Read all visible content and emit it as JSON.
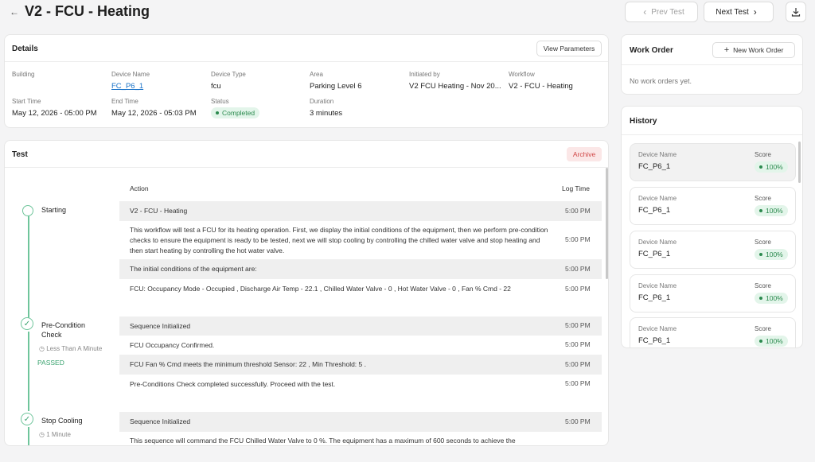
{
  "header": {
    "title": "V2 - FCU - Heating",
    "prev_label": "Prev Test",
    "next_label": "Next Test"
  },
  "details": {
    "title": "Details",
    "view_params_label": "View Parameters",
    "fields": {
      "building": {
        "label": "Building",
        "value": ""
      },
      "device_name": {
        "label": "Device Name",
        "value": "FC_P6_1"
      },
      "device_type": {
        "label": "Device Type",
        "value": "fcu"
      },
      "area": {
        "label": "Area",
        "value": "Parking Level 6"
      },
      "initiated_by": {
        "label": "Initiated by",
        "value": "V2 FCU Heating - Nov 20..."
      },
      "workflow": {
        "label": "Workflow",
        "value": "V2 - FCU - Heating"
      },
      "start_time": {
        "label": "Start Time",
        "value": "May 12, 2026 - 05:00 PM"
      },
      "end_time": {
        "label": "End Time",
        "value": "May 12, 2026 - 05:03 PM"
      },
      "status": {
        "label": "Status",
        "value": "Completed"
      },
      "duration": {
        "label": "Duration",
        "value": "3 minutes"
      }
    }
  },
  "test": {
    "title": "Test",
    "archive_label": "Archive",
    "col_action": "Action",
    "col_log_time": "Log Time",
    "steps": [
      {
        "label": "Starting",
        "sub": "",
        "result": ""
      },
      {
        "label": "Pre-Condition Check",
        "sub": "Less Than A Minute",
        "result": "PASSED"
      },
      {
        "label": "Stop Cooling",
        "sub": "1 Minute",
        "result": ""
      }
    ],
    "rows": [
      {
        "text": "V2 - FCU - Heating",
        "time": "5:00 PM"
      },
      {
        "text": "This workflow will test a FCU for its heating operation. First, we display the initial conditions of the equipment, then we perform pre-condition checks to ensure the equipment is ready to be tested, next we will stop cooling by controlling the chilled water valve and stop heating and then start heating by controlling the hot water valve.",
        "time": "5:00 PM"
      },
      {
        "text": "The initial conditions of the equipment are:",
        "time": "5:00 PM"
      },
      {
        "text": "FCU: Occupancy Mode - Occupied , Discharge Air Temp - 22.1 , Chilled Water Valve - 0 , Hot Water Valve - 0 , Fan % Cmd - 22",
        "time": "5:00 PM"
      },
      {
        "text": "Sequence Initialized",
        "time": "5:00 PM"
      },
      {
        "text": "FCU Occupancy Confirmed.",
        "time": "5:00 PM"
      },
      {
        "text": "FCU Fan % Cmd meets the minimum threshold Sensor: 22 , Min Threshold: 5 .",
        "time": "5:00 PM"
      },
      {
        "text": "Pre-Conditions Check completed successfully. Proceed with the test.",
        "time": "5:00 PM"
      },
      {
        "text": "Sequence Initialized",
        "time": "5:00 PM"
      },
      {
        "text": "This sequence will command the FCU Chilled Water Valve to 0 %. The equipment has a maximum of 600 seconds to achieve the",
        "time": ""
      }
    ]
  },
  "work_order": {
    "title": "Work Order",
    "new_label": "New Work Order",
    "empty_text": "No work orders yet."
  },
  "history": {
    "title": "History",
    "items": [
      {
        "name_label": "Device Name",
        "name": "FC_P6_1",
        "score_label": "Score",
        "score": "100%"
      },
      {
        "name_label": "Device Name",
        "name": "FC_P6_1",
        "score_label": "Score",
        "score": "100%"
      },
      {
        "name_label": "Device Name",
        "name": "FC_P6_1",
        "score_label": "Score",
        "score": "100%"
      },
      {
        "name_label": "Device Name",
        "name": "FC_P6_1",
        "score_label": "Score",
        "score": "100%"
      },
      {
        "name_label": "Device Name",
        "name": "FC_P6_1",
        "score_label": "Score",
        "score": "100%"
      }
    ]
  },
  "colors": {
    "accent_green": "#3aa36f",
    "link_blue": "#1a73c8",
    "archive_red": "#d04545"
  },
  "icons": {
    "back": "arrow-left-icon",
    "download": "download-icon",
    "clock": "clock-icon",
    "check": "check-icon",
    "plus": "plus-icon"
  }
}
